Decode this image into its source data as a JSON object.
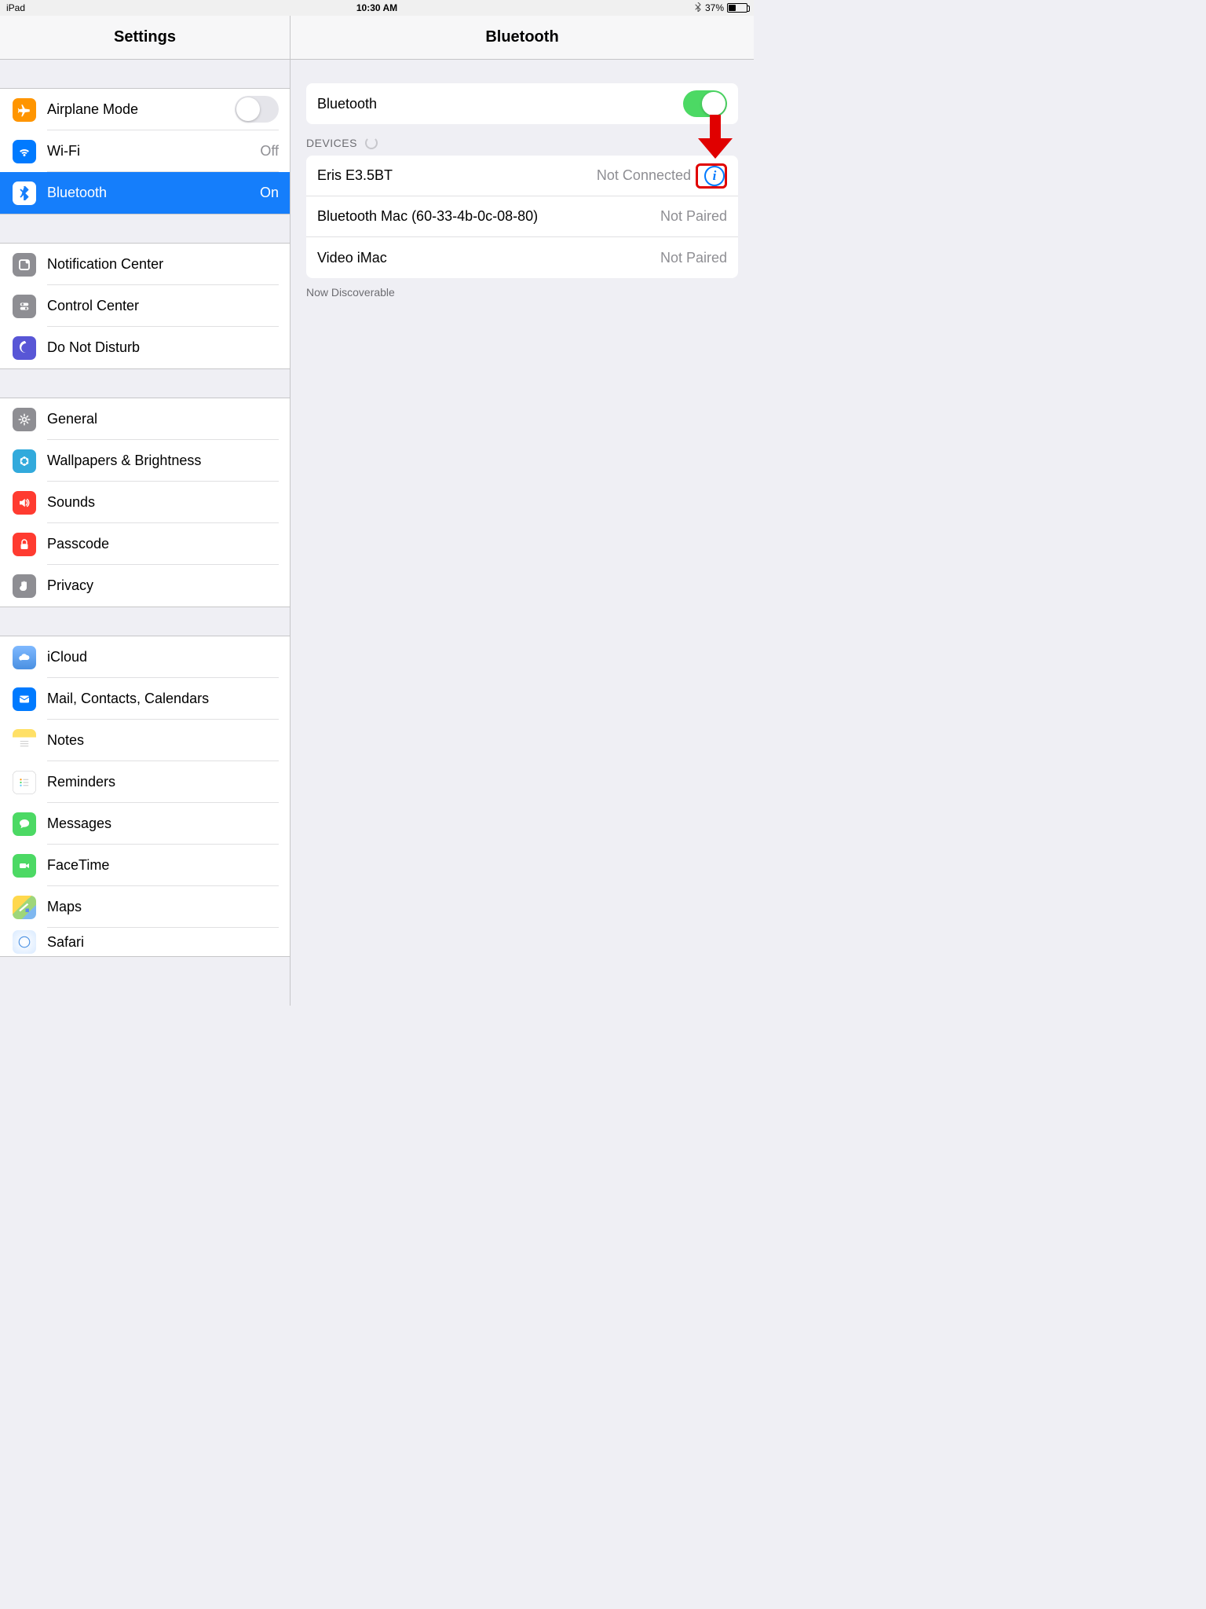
{
  "status": {
    "device": "iPad",
    "time": "10:30 AM",
    "battery_pct": "37%"
  },
  "sidebar": {
    "title": "Settings",
    "g1": [
      {
        "label": "Airplane Mode",
        "value": ""
      },
      {
        "label": "Wi-Fi",
        "value": "Off"
      },
      {
        "label": "Bluetooth",
        "value": "On"
      }
    ],
    "g2": [
      {
        "label": "Notification Center"
      },
      {
        "label": "Control Center"
      },
      {
        "label": "Do Not Disturb"
      }
    ],
    "g3": [
      {
        "label": "General"
      },
      {
        "label": "Wallpapers & Brightness"
      },
      {
        "label": "Sounds"
      },
      {
        "label": "Passcode"
      },
      {
        "label": "Privacy"
      }
    ],
    "g4": [
      {
        "label": "iCloud"
      },
      {
        "label": "Mail, Contacts, Calendars"
      },
      {
        "label": "Notes"
      },
      {
        "label": "Reminders"
      },
      {
        "label": "Messages"
      },
      {
        "label": "FaceTime"
      },
      {
        "label": "Maps"
      },
      {
        "label": "Safari"
      }
    ]
  },
  "detail": {
    "title": "Bluetooth",
    "toggle_label": "Bluetooth",
    "toggle_on": true,
    "section_header": "DEVICES",
    "devices": [
      {
        "name": "Eris E3.5BT",
        "status": "Not Connected",
        "has_info": true
      },
      {
        "name": "Bluetooth Mac (60-33-4b-0c-08-80)",
        "status": "Not Paired",
        "has_info": false
      },
      {
        "name": "Video iMac",
        "status": "Not Paired",
        "has_info": false
      }
    ],
    "footer": "Now Discoverable"
  },
  "callout": {
    "arrow_color": "#e00000"
  }
}
